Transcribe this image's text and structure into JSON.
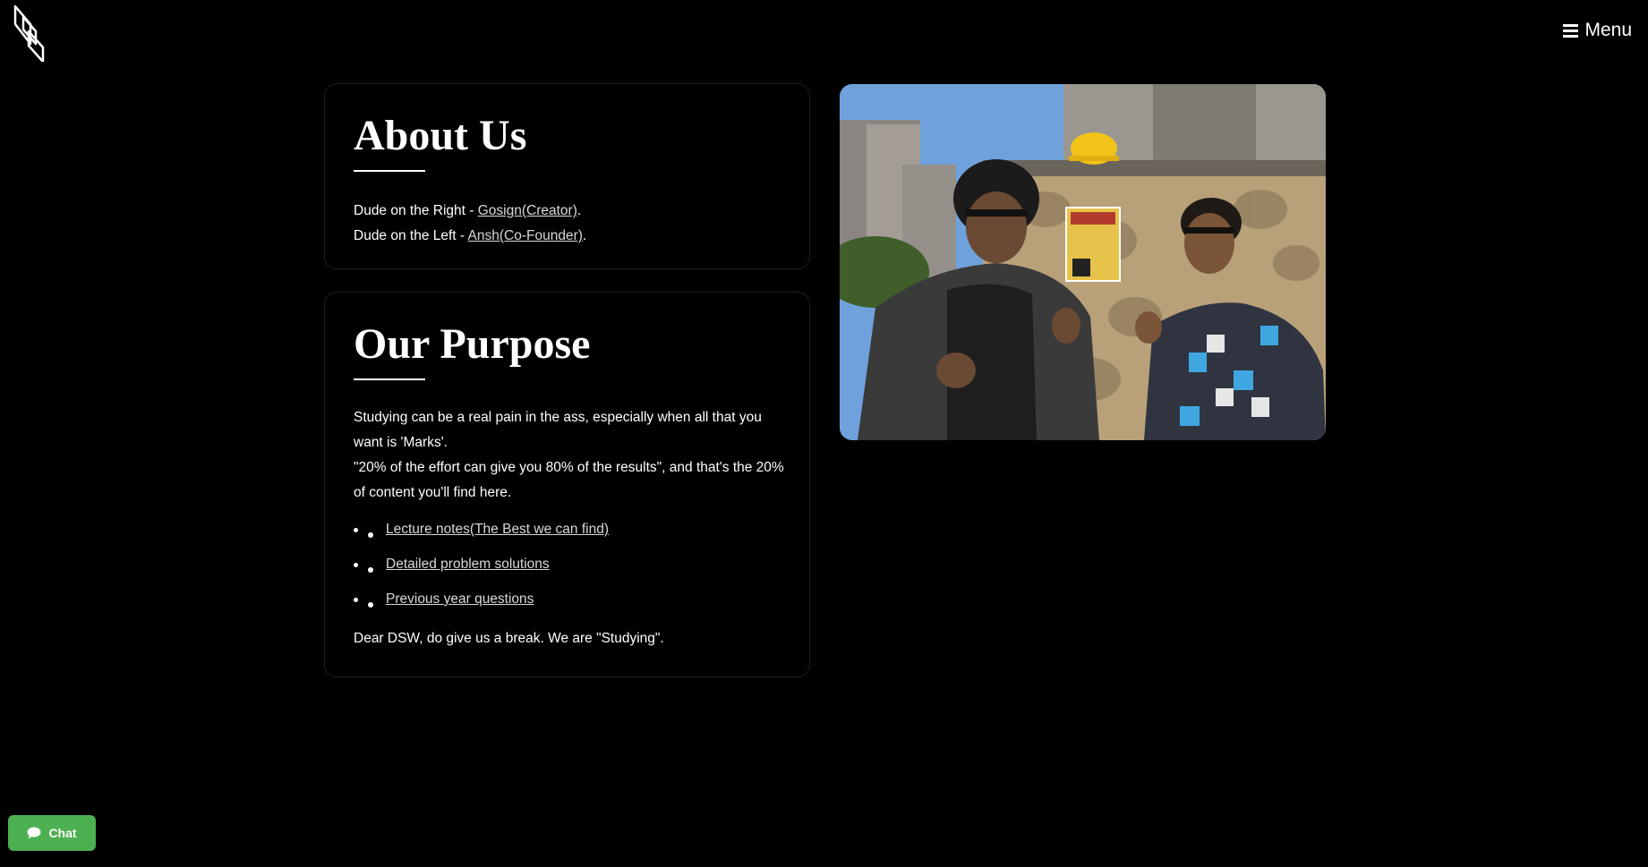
{
  "header": {
    "logo_icon": "leaf-logo-icon",
    "menu_icon": "hamburger-icon",
    "menu_label": "Menu"
  },
  "about": {
    "title": "About Us",
    "line1_prefix": "Dude on the Right - ",
    "line1_link": "Gosign(Creator)",
    "line2_prefix": "Dude on the Left - ",
    "line2_link": "Ansh(Co-Founder)",
    "line_suffix": "."
  },
  "purpose": {
    "title": "Our Purpose",
    "paragraph1": "Studying can be a real pain in the ass, especially when all that you want is 'Marks'.",
    "paragraph2": "\"20% of the effort can give you 80% of the results\", and that's the 20% of content you'll find here.",
    "links": [
      "Lecture notes(The Best we can find)",
      "Detailed problem solutions",
      "Previous year questions"
    ],
    "closing": "Dear DSW, do give us a break. We are \"Studying\"."
  },
  "photo": {
    "description_icon": "founders-photo"
  },
  "chat": {
    "icon": "chat-bubble-icon",
    "label": "Chat",
    "color": "#4caf50"
  }
}
